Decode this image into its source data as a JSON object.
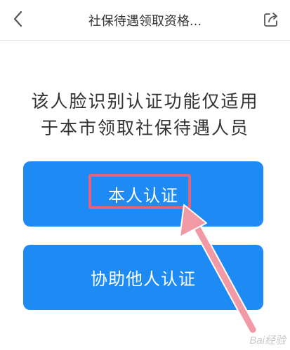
{
  "header": {
    "title": "社保待遇领取资格...",
    "back_icon": "back-chevron-icon",
    "share_icon": "share-icon"
  },
  "notice": {
    "line1": "该人脸识别认证功能仅适用",
    "line2": "于本市领取社保待遇人员"
  },
  "buttons": {
    "self": "本人认证",
    "other": "协助他人认证"
  },
  "annotation": {
    "highlight_color": "#e2637a",
    "arrow_color": "#f19aa6"
  },
  "watermark": "Bai经验",
  "colors": {
    "button_bg": "#1e8bf5",
    "button_text": "#ffffff"
  }
}
